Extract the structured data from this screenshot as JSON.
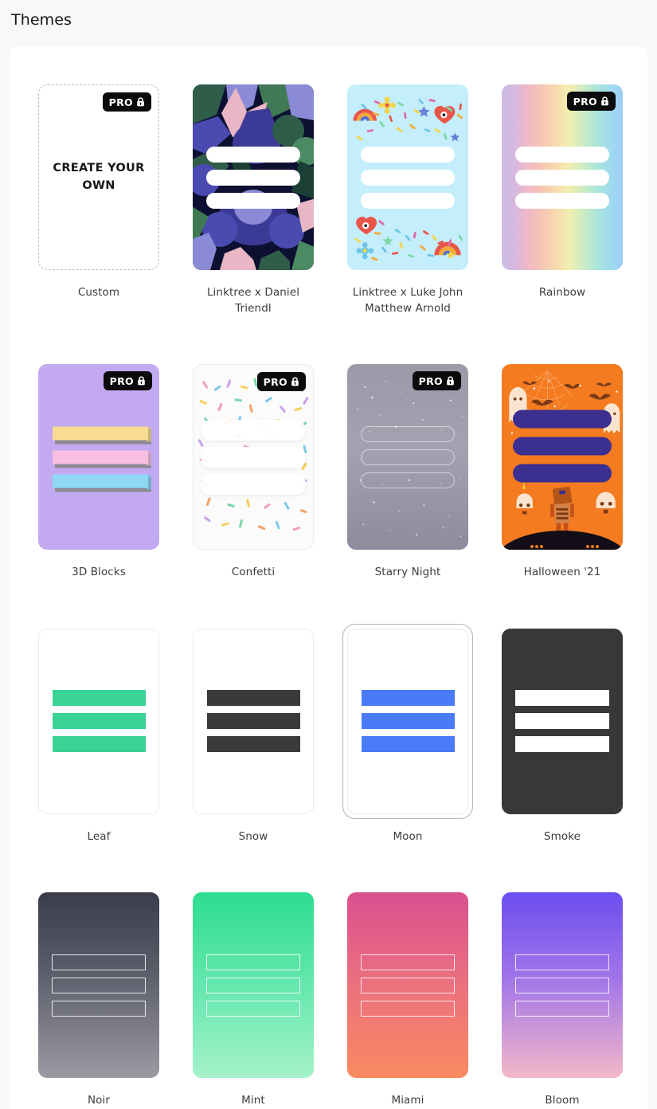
{
  "header": {
    "title": "Themes"
  },
  "pro_badge": {
    "label": "PRO",
    "icon": "lock-icon",
    "bg": "#0b0b0d",
    "fg": "#ffffff"
  },
  "selected_theme": "Moon",
  "colors": {
    "page_bg": "#f7f8f9",
    "panel_bg": "#ffffff",
    "label": "#3c3c41",
    "selection_ring": "#b3b3b8"
  },
  "themes": [
    {
      "id": "custom",
      "label": "Custom",
      "cta": "CREATE YOUR OWN",
      "pro": true,
      "style": "dashed-placeholder",
      "bars": 0
    },
    {
      "id": "linktree-x-daniel-triendl",
      "label": "Linktree x Daniel Triendl",
      "pro": false,
      "style": "artwork-floral",
      "bars": 3,
      "bar_style": "white-pill"
    },
    {
      "id": "linktree-x-luke-john-matthew-arnold",
      "label": "Linktree x Luke John Matthew Arnold",
      "pro": false,
      "style": "artwork-stickers",
      "bg": "#c4eefb",
      "bars": 3,
      "bar_style": "white-pill"
    },
    {
      "id": "rainbow",
      "label": "Rainbow",
      "pro": true,
      "style": "gradient-horizontal",
      "bars": 3,
      "bar_style": "white-pill"
    },
    {
      "id": "3d-blocks",
      "label": "3D Blocks",
      "pro": true,
      "style": "blocks-3d",
      "bg": "#c3a9f0",
      "bars": 3,
      "bar_colors": [
        "#f8dc93",
        "#f9bfe0",
        "#8ed8f6"
      ]
    },
    {
      "id": "confetti",
      "label": "Confetti",
      "pro": true,
      "style": "sprinkles",
      "bg": "#fbfbfb",
      "bars": 3,
      "bar_style": "translucent-white-pill"
    },
    {
      "id": "starry-night",
      "label": "Starry Night",
      "pro": true,
      "style": "gradient-stars",
      "bars": 3,
      "bar_style": "outline-pill"
    },
    {
      "id": "halloween-21",
      "label": "Halloween '21",
      "pro": false,
      "style": "artwork-halloween",
      "bg": "#f47b20",
      "bars": 3,
      "bar_colors": [
        "#3b2f8f",
        "#3b2f8f",
        "#3b2f8f"
      ]
    },
    {
      "id": "leaf",
      "label": "Leaf",
      "pro": false,
      "style": "flat",
      "bg": "#ffffff",
      "bars": 3,
      "bar_colors": [
        "#3ad295",
        "#3ad295",
        "#3ad295"
      ]
    },
    {
      "id": "snow",
      "label": "Snow",
      "pro": false,
      "style": "flat",
      "bg": "#ffffff",
      "bars": 3,
      "bar_colors": [
        "#3a3a3c",
        "#3a3a3c",
        "#3a3a3c"
      ]
    },
    {
      "id": "moon",
      "label": "Moon",
      "pro": false,
      "style": "flat",
      "bg": "#ffffff",
      "bars": 3,
      "bar_colors": [
        "#4a7bf7",
        "#4a7bf7",
        "#4a7bf7"
      ],
      "selected": true
    },
    {
      "id": "smoke",
      "label": "Smoke",
      "pro": false,
      "style": "flat",
      "bg": "#383838",
      "bars": 3,
      "bar_colors": [
        "#ffffff",
        "#ffffff",
        "#ffffff"
      ]
    },
    {
      "id": "noir",
      "label": "Noir",
      "pro": false,
      "style": "gradient-vertical",
      "bars": 3,
      "bar_style": "outline-square"
    },
    {
      "id": "mint",
      "label": "Mint",
      "pro": false,
      "style": "gradient-vertical",
      "bars": 3,
      "bar_style": "outline-square"
    },
    {
      "id": "miami",
      "label": "Miami",
      "pro": false,
      "style": "gradient-vertical",
      "bars": 3,
      "bar_style": "outline-square"
    },
    {
      "id": "bloom",
      "label": "Bloom",
      "pro": false,
      "style": "gradient-vertical",
      "bars": 3,
      "bar_style": "outline-square"
    }
  ]
}
